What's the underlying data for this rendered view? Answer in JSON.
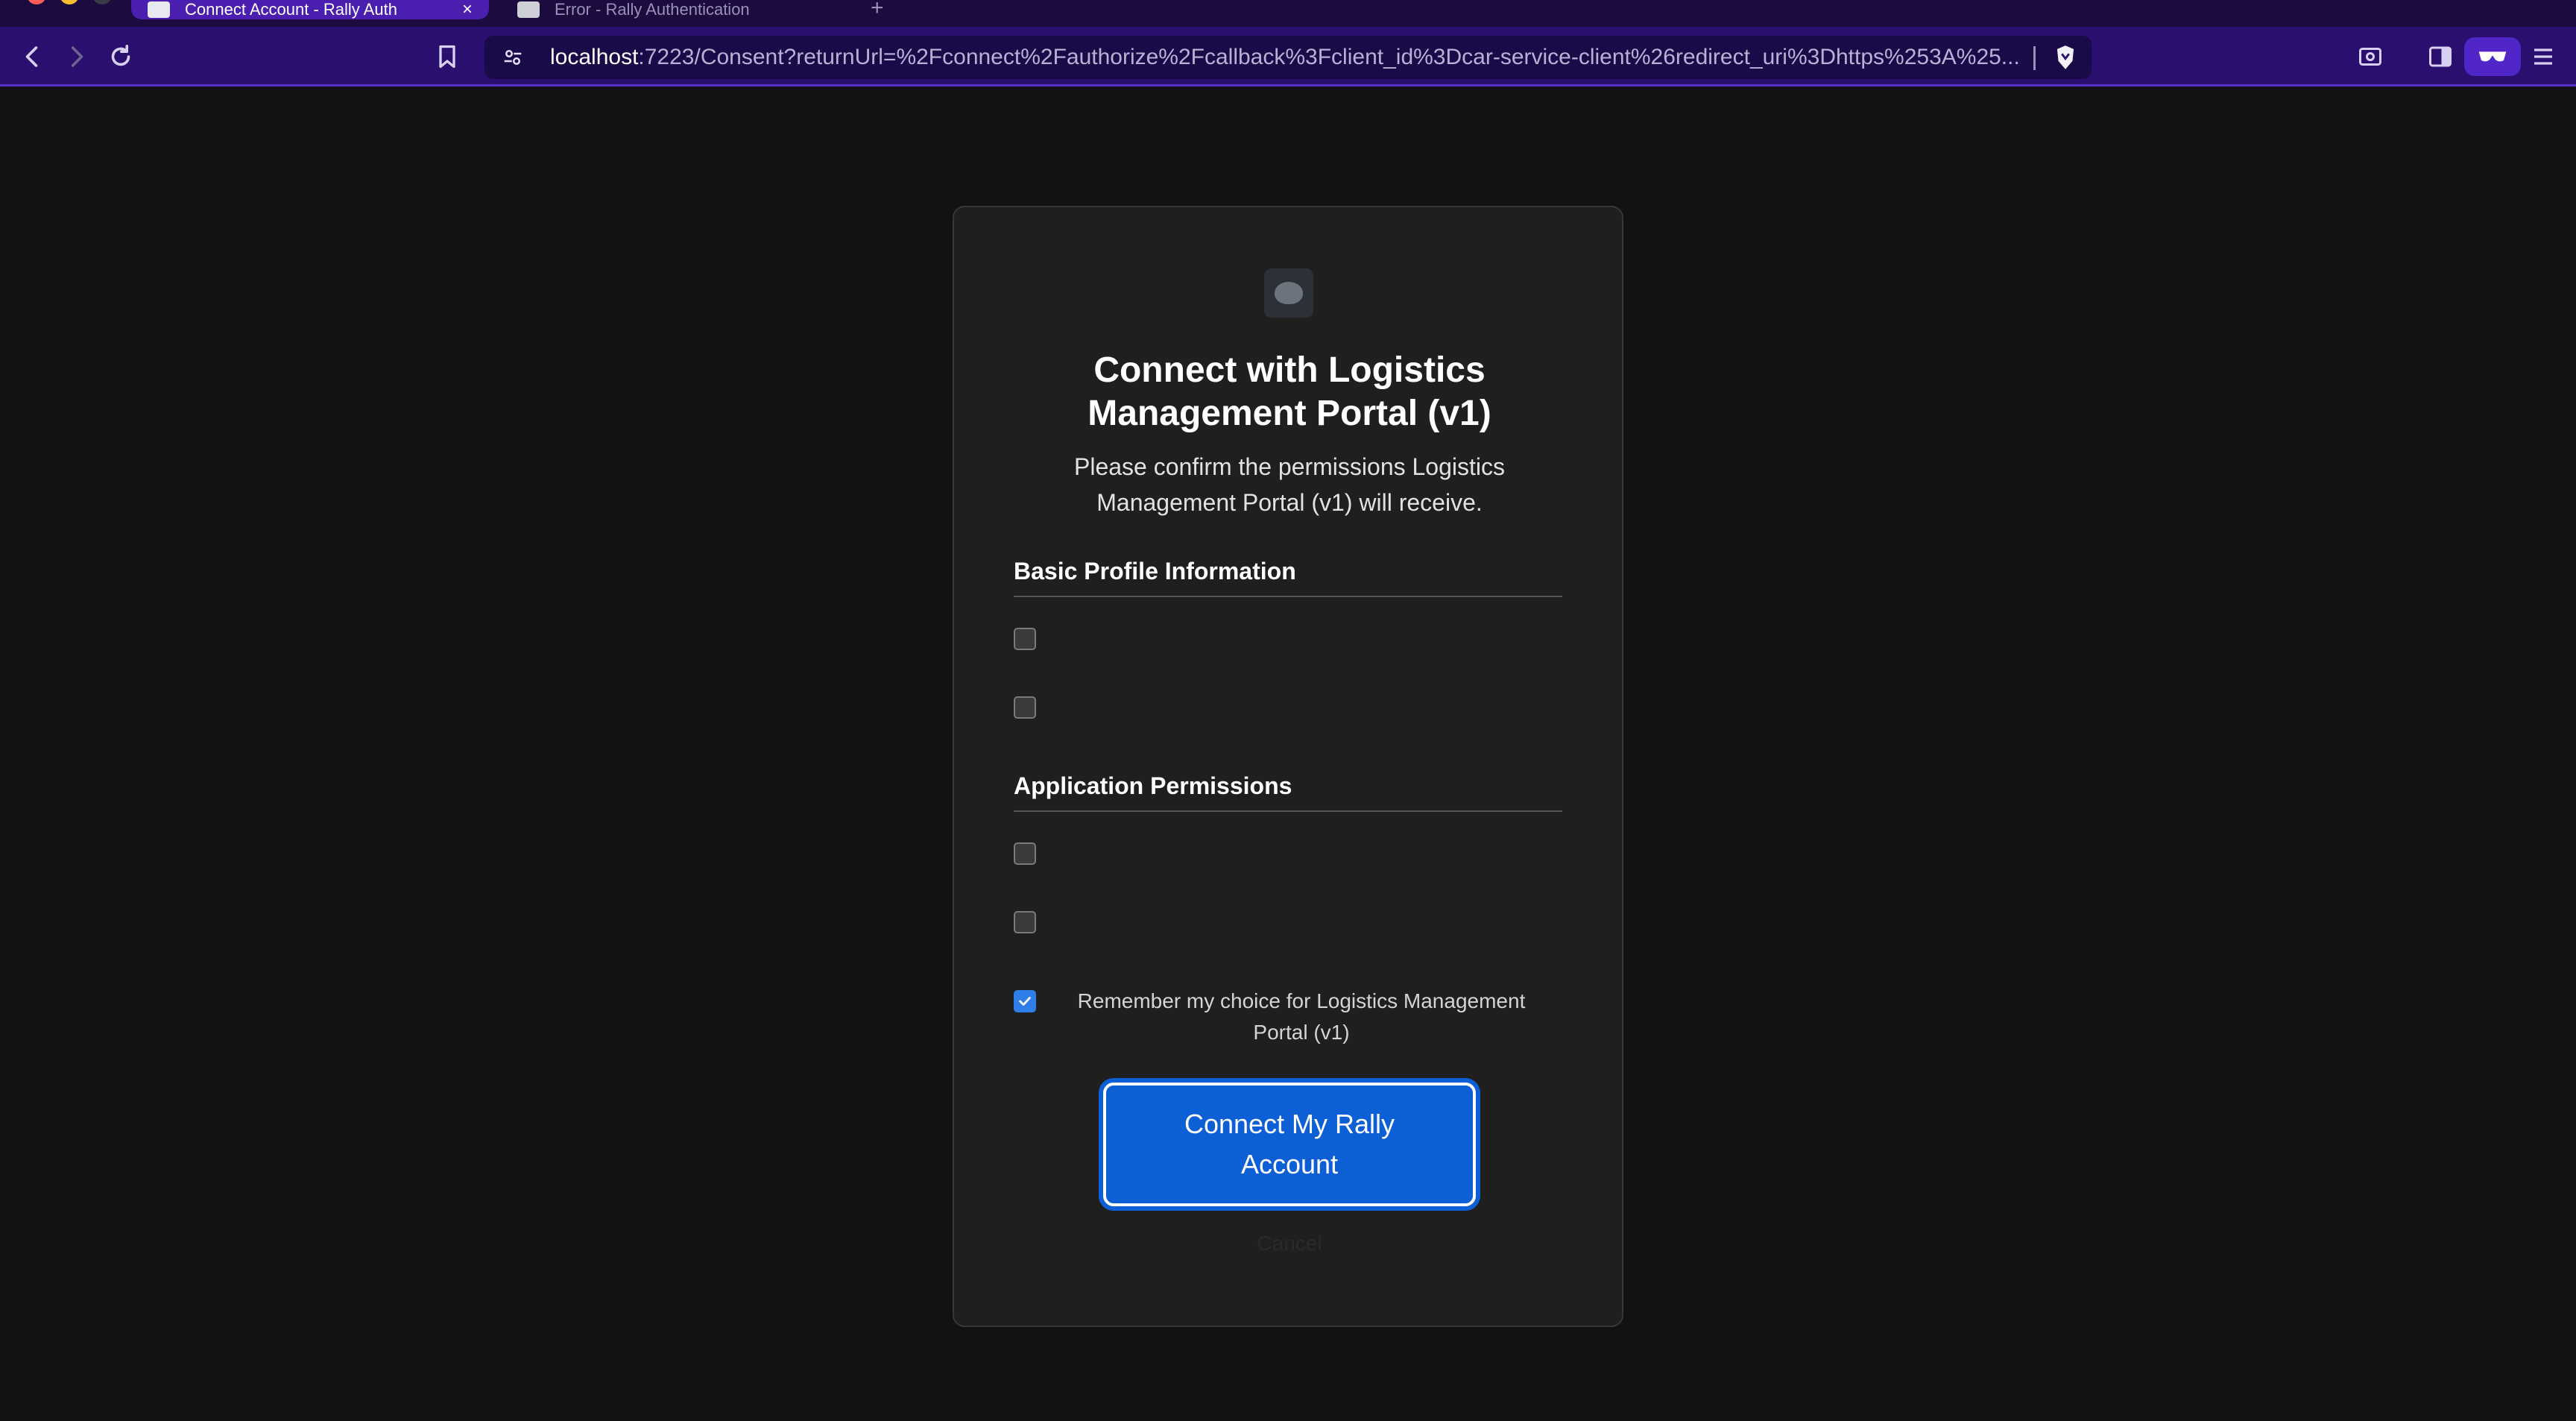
{
  "browser": {
    "tabs": [
      {
        "title": "Connect Account - Rally Auth",
        "close": "×"
      },
      {
        "title": "Error - Rally Authentication"
      }
    ],
    "new_tab": "+",
    "url": {
      "host": "localhost",
      "rest": ":7223/Consent?returnUrl=%2Fconnect%2Fauthorize%2Fcallback%3Fclient_id%3Dcar-service-client%26redirect_uri%3Dhttps%253A%25..."
    }
  },
  "consent": {
    "title": "Connect with Logistics Management Portal (v1)",
    "subtitle": "Please confirm the permissions Logistics Management Portal (v1) will receive.",
    "sections": [
      {
        "heading": "Basic Profile Information"
      },
      {
        "heading": "Application Permissions"
      }
    ],
    "remember_label": "Remember my choice for Logistics Management Portal (v1)",
    "connect_button": "Connect My Rally Account",
    "cancel_link": "Cancel"
  },
  "colors": {
    "accent": "#0d5fd6",
    "chrome": "#2a0f6e",
    "page_bg": "#121212"
  }
}
